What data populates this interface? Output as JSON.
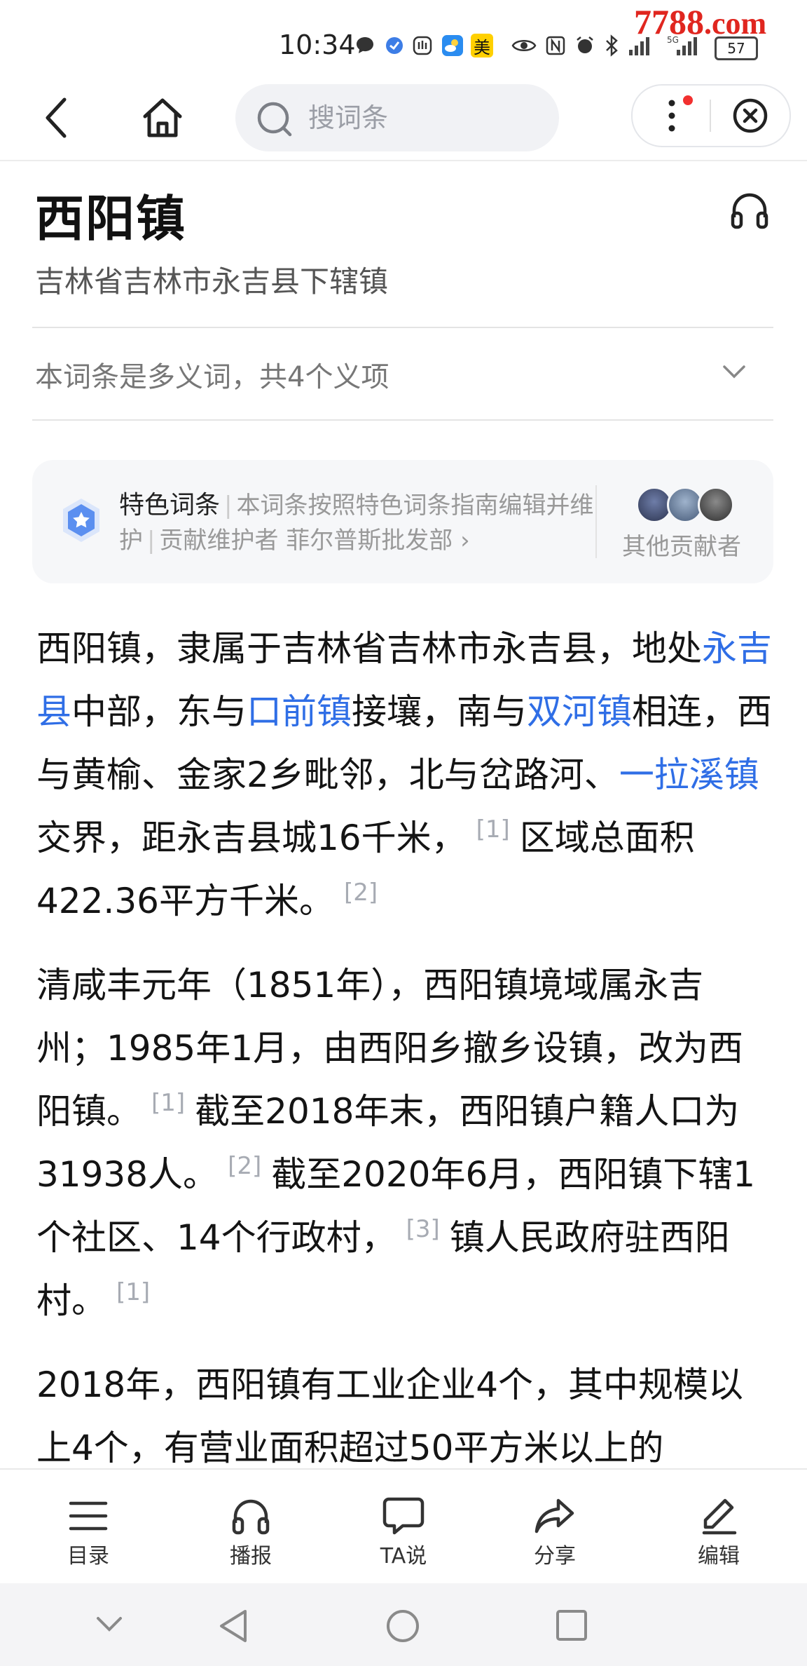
{
  "status_bar": {
    "time": "10:34",
    "watermark_main": "7788",
    "watermark_suffix": ".com",
    "battery": "57",
    "meituan_badge": "美",
    "network": "5G"
  },
  "nav": {
    "search_placeholder": "搜词条",
    "icons": [
      "back-icon",
      "home-icon",
      "search-icon",
      "more-icon",
      "close-icon"
    ]
  },
  "entry": {
    "title": "西阳镇",
    "subtitle": "吉林省吉林市永吉县下辖镇",
    "polysemy": "本词条是多义词，共4个义项"
  },
  "featured": {
    "label": "特色词条",
    "description": "本词条按照特色词条指南编辑并维护",
    "contributor_prefix": "贡献维护者",
    "contributor": "菲尔普斯批发部",
    "arrow": "›",
    "others": "其他贡献者"
  },
  "article": {
    "p1": {
      "t1": "西阳镇，隶属于吉林省吉林市永吉县，地处",
      "l1": "永吉县",
      "t2": "中部，东与",
      "l2": "口前镇",
      "t3": "接壤，南与",
      "l3": "双河镇",
      "t4": "相连，西与黄榆、金家2乡毗邻，北与岔路河、",
      "l4": "一拉溪镇",
      "t5": "交界，距永吉县城16千米，",
      "r1": "[1]",
      "t6": "区域总面积422.36平方千米。",
      "r2": "[2]"
    },
    "p2": {
      "t1": "清咸丰元年（1851年），西阳镇境域属永吉州；1985年1月，由西阳乡撤乡设镇，改为西阳镇。",
      "r1": "[1]",
      "t2": "截至2018年末，西阳镇户籍人口为31938人。",
      "r2": "[2]",
      "t3": "截至2020年6月，西阳镇下辖1个社区、14个行政村，",
      "r3": "[3]",
      "t4": "镇人民政府驻西阳村。",
      "r4": "[1]"
    },
    "p3": {
      "t1": "2018年，西阳镇有工业企业4个，其中规模以上4个，有营业面积超过50平方米以上的"
    }
  },
  "bottom_tabs": [
    {
      "label": "目录",
      "icon": "catalog-icon"
    },
    {
      "label": "播报",
      "icon": "headphones-icon"
    },
    {
      "label": "TA说",
      "icon": "chat-icon"
    },
    {
      "label": "分享",
      "icon": "share-icon"
    },
    {
      "label": "编辑",
      "icon": "edit-icon"
    }
  ],
  "colors": {
    "link": "#2f6ee6",
    "watermark": "#e0261f",
    "notification_dot": "#f2302f",
    "badge_blue": "#5b8ff0"
  }
}
